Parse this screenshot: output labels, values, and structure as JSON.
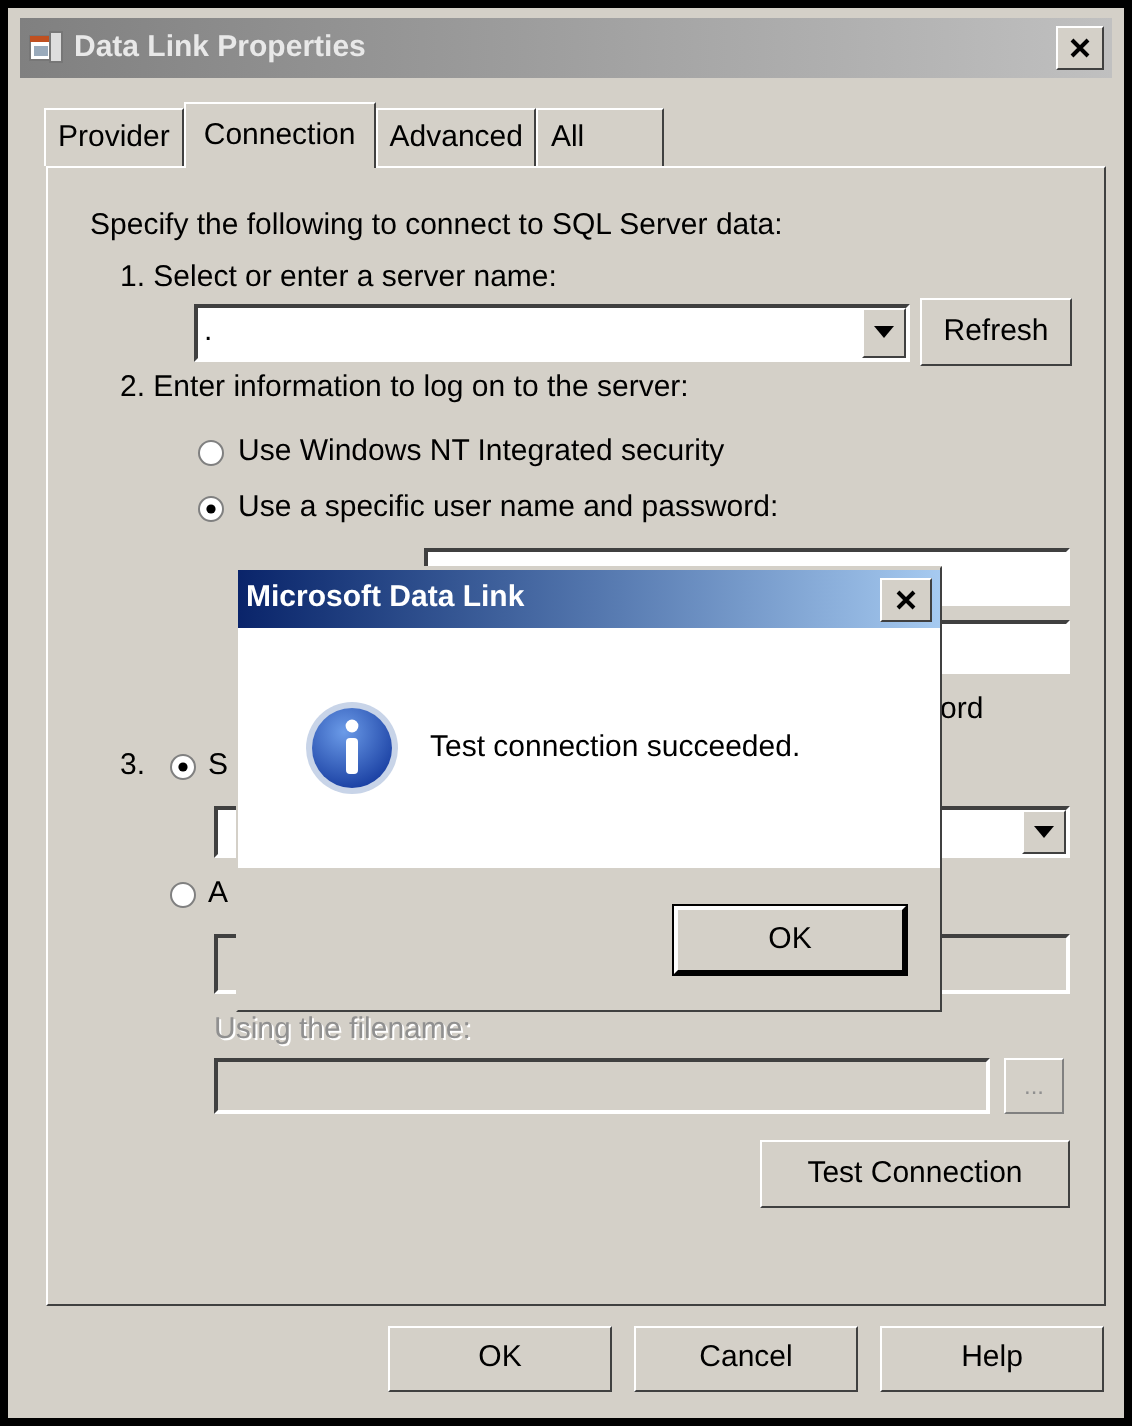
{
  "window": {
    "title": "Data Link Properties"
  },
  "tabs": [
    {
      "label": "Provider",
      "selected": false
    },
    {
      "label": "Connection",
      "selected": true
    },
    {
      "label": "Advanced",
      "selected": false
    },
    {
      "label": "All",
      "selected": false
    }
  ],
  "connection": {
    "intro": "Specify the following to connect to SQL Server data:",
    "step1": "1. Select or enter a server name:",
    "server_name": ".",
    "refresh_button": "Refresh",
    "step2": "2. Enter information to log on to the server:",
    "logon_options": [
      {
        "label": "Use Windows NT Integrated security",
        "selected": false
      },
      {
        "label": "Use a specific user name and password:",
        "selected": true
      }
    ],
    "password_option_fragment": "ord",
    "step3_number": "3.",
    "database_options": [
      {
        "label": "S",
        "selected": true
      },
      {
        "label": "A",
        "selected": false
      }
    ],
    "filename_label": "Using the filename:",
    "browse_button": "...",
    "test_button": "Test Connection"
  },
  "buttons": [
    "OK",
    "Cancel",
    "Help"
  ],
  "message_box": {
    "title": "Microsoft Data Link",
    "message": "Test connection succeeded.",
    "button": "OK"
  }
}
